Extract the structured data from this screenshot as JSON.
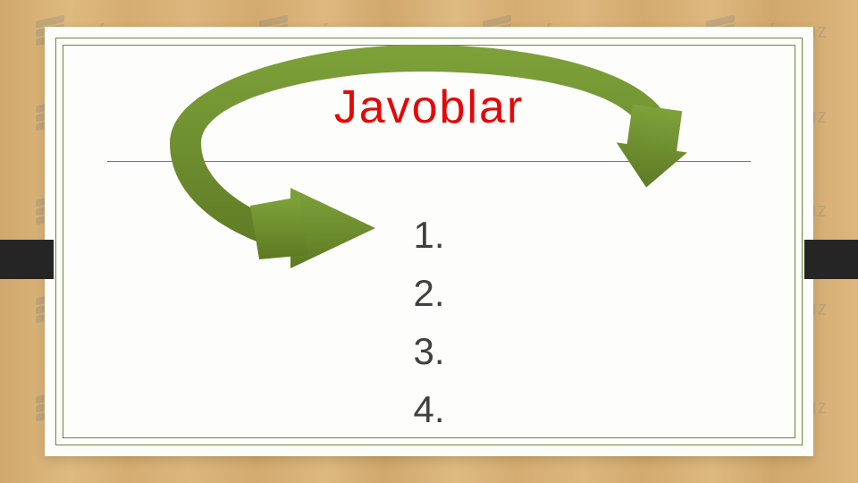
{
  "watermark": {
    "text": "oefen.uz"
  },
  "slide": {
    "title": "Javoblar",
    "list": {
      "item1": "1.",
      "item2": "2.",
      "item3": "3.",
      "item4": "4."
    }
  },
  "colors": {
    "accent": "#6a8a30",
    "arrow": "#6e8c2f",
    "title": "#e40808"
  }
}
